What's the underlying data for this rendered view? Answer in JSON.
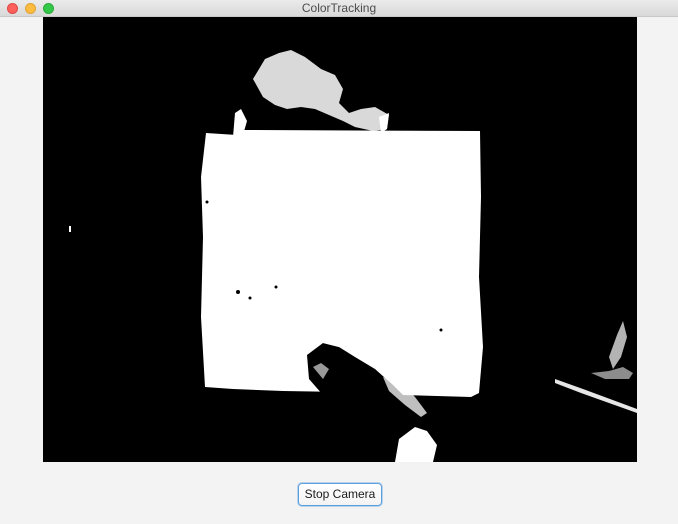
{
  "window": {
    "title": "ColorTracking"
  },
  "controls": {
    "stop_camera_label": "Stop Camera"
  },
  "colors": {
    "close": "#fc605c",
    "minimize": "#fdbc40",
    "maximize": "#34c84a",
    "button_focus": "#5aa0dc"
  }
}
